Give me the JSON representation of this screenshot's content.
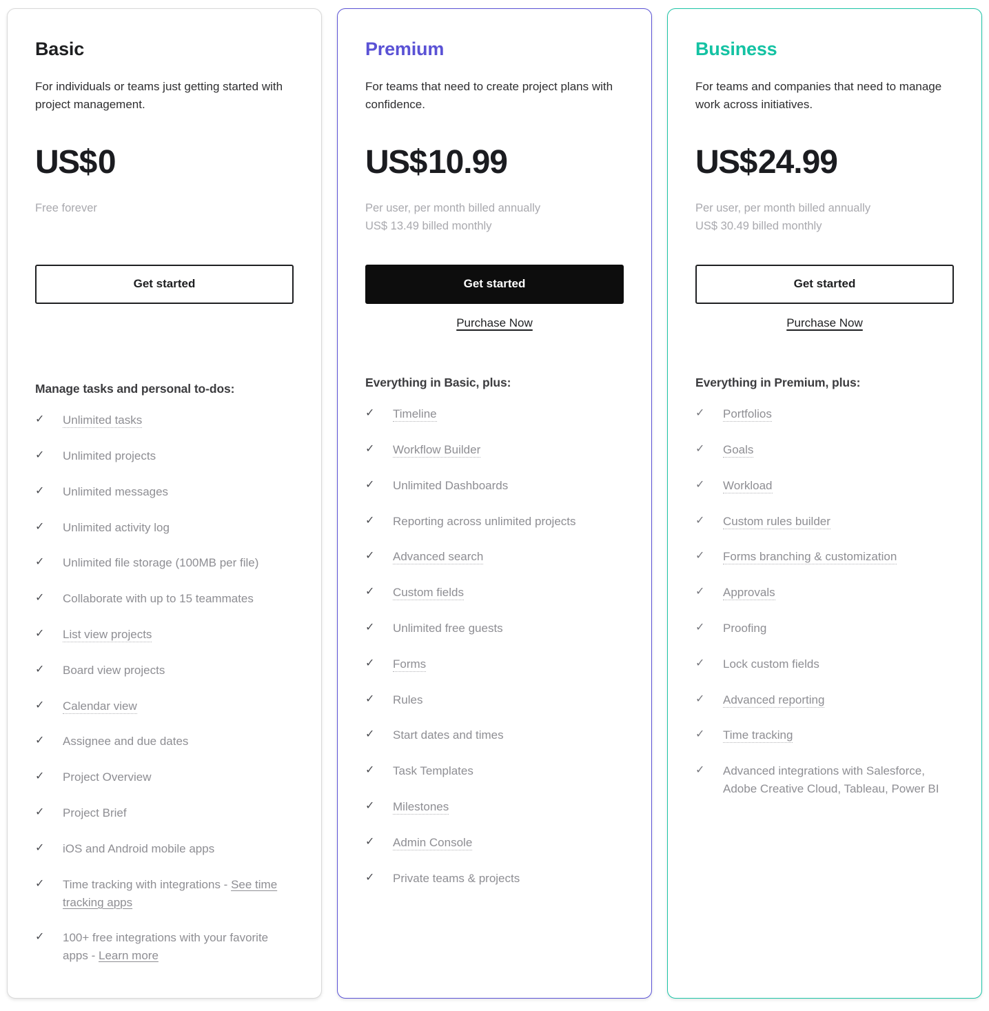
{
  "icons": {
    "check": "✓"
  },
  "colors": {
    "basic_accent": "#1e1f21",
    "premium_accent": "#5a52d5",
    "business_accent": "#14c2a3",
    "price_text": "#1b1c20",
    "muted_text": "#8e8e93"
  },
  "plans": [
    {
      "id": "basic",
      "name": "Basic",
      "tagline": "For individuals or teams just getting started with project management.",
      "price_currency": "US$",
      "price_amount": "0",
      "billing_lines": [
        "Free forever"
      ],
      "cta_label": "Get started",
      "cta_style": "outline",
      "purchase_label": null,
      "features_heading": "Manage tasks and personal to-dos:",
      "features": [
        {
          "text": "Unlimited tasks",
          "tooltip": true
        },
        {
          "text": "Unlimited projects",
          "tooltip": false
        },
        {
          "text": "Unlimited messages",
          "tooltip": false
        },
        {
          "text": "Unlimited activity log",
          "tooltip": false
        },
        {
          "text": "Unlimited file storage (100MB per file)",
          "tooltip": false
        },
        {
          "text": "Collaborate with up to 15 teammates",
          "tooltip": false
        },
        {
          "text": "List view projects",
          "tooltip": true
        },
        {
          "text": "Board view projects",
          "tooltip": false
        },
        {
          "text": "Calendar view",
          "tooltip": true
        },
        {
          "text": "Assignee and due dates",
          "tooltip": false
        },
        {
          "text": "Project Overview",
          "tooltip": false
        },
        {
          "text": "Project Brief",
          "tooltip": false
        },
        {
          "text": "iOS and Android mobile apps",
          "tooltip": false
        },
        {
          "text": "Time tracking with integrations - ",
          "tooltip": false,
          "link_text": "See time tracking apps"
        },
        {
          "text": "100+ free integrations with your favorite apps - ",
          "tooltip": false,
          "link_text": "Learn more"
        }
      ]
    },
    {
      "id": "premium",
      "name": "Premium",
      "tagline": "For teams that need to create project plans with confidence.",
      "price_currency": "US$",
      "price_amount": "10.99",
      "billing_lines": [
        "Per user, per month billed annually",
        "US$ 13.49 billed monthly"
      ],
      "cta_label": "Get started",
      "cta_style": "solid",
      "purchase_label": "Purchase Now",
      "features_heading": "Everything in Basic, plus:",
      "features": [
        {
          "text": "Timeline",
          "tooltip": true
        },
        {
          "text": "Workflow Builder",
          "tooltip": true
        },
        {
          "text": "Unlimited Dashboards",
          "tooltip": false
        },
        {
          "text": "Reporting across unlimited projects",
          "tooltip": false
        },
        {
          "text": "Advanced search",
          "tooltip": true
        },
        {
          "text": "Custom fields",
          "tooltip": true
        },
        {
          "text": "Unlimited free guests",
          "tooltip": false
        },
        {
          "text": "Forms",
          "tooltip": true
        },
        {
          "text": "Rules",
          "tooltip": false
        },
        {
          "text": "Start dates and times",
          "tooltip": false
        },
        {
          "text": "Task Templates",
          "tooltip": false
        },
        {
          "text": "Milestones",
          "tooltip": true
        },
        {
          "text": "Admin Console",
          "tooltip": true
        },
        {
          "text": "Private teams & projects",
          "tooltip": false
        }
      ]
    },
    {
      "id": "business",
      "name": "Business",
      "tagline": "For teams and companies that need to manage work across initiatives.",
      "price_currency": "US$",
      "price_amount": "24.99",
      "billing_lines": [
        "Per user, per month billed annually",
        "US$ 30.49 billed monthly"
      ],
      "cta_label": "Get started",
      "cta_style": "outline",
      "purchase_label": "Purchase Now",
      "features_heading": "Everything in Premium, plus:",
      "features": [
        {
          "text": "Portfolios",
          "tooltip": true
        },
        {
          "text": "Goals",
          "tooltip": true
        },
        {
          "text": "Workload",
          "tooltip": true
        },
        {
          "text": "Custom rules builder",
          "tooltip": true
        },
        {
          "text": "Forms branching & customization",
          "tooltip": true
        },
        {
          "text": "Approvals",
          "tooltip": true
        },
        {
          "text": "Proofing",
          "tooltip": false
        },
        {
          "text": "Lock custom fields",
          "tooltip": false
        },
        {
          "text": "Advanced reporting",
          "tooltip": true
        },
        {
          "text": "Time tracking",
          "tooltip": true
        },
        {
          "text": "Advanced integrations with Salesforce, Adobe Creative Cloud, Tableau, Power BI",
          "tooltip": false
        }
      ]
    }
  ]
}
